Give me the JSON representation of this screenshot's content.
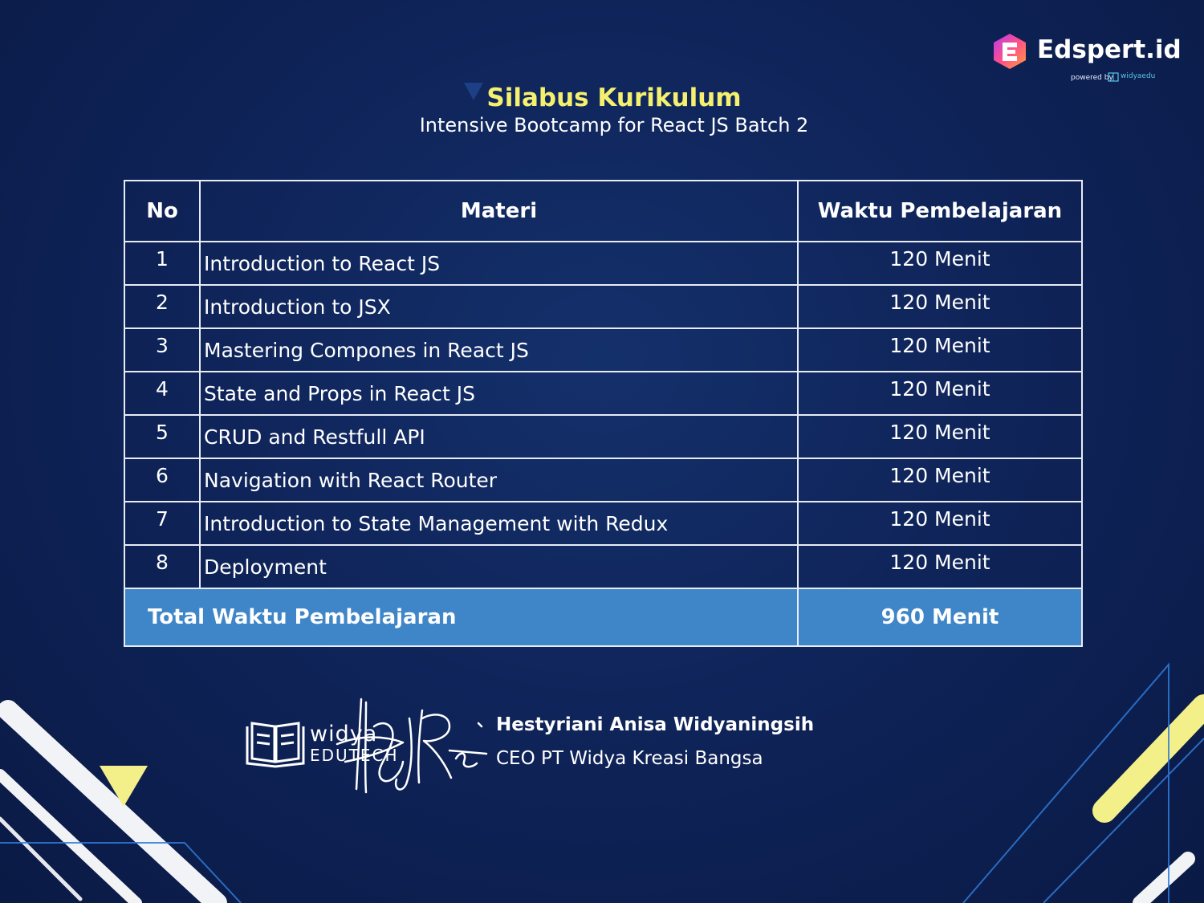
{
  "brand": {
    "name": "Edspert.id",
    "powered_by": "powered by",
    "partner": "widyaedu"
  },
  "header": {
    "title": "Silabus Kurikulum",
    "subtitle": "Intensive Bootcamp for React JS Batch 2"
  },
  "table": {
    "columns": [
      "No",
      "Materi",
      "Waktu Pembelajaran"
    ],
    "rows": [
      {
        "no": "1",
        "materi": "Introduction to React JS",
        "waktu": "120 Menit"
      },
      {
        "no": "2",
        "materi": "Introduction to JSX",
        "waktu": "120 Menit"
      },
      {
        "no": "3",
        "materi": "Mastering Compones in React JS",
        "waktu": "120 Menit"
      },
      {
        "no": "4",
        "materi": "State and Props in React JS",
        "waktu": "120 Menit"
      },
      {
        "no": "5",
        "materi": "CRUD and Restfull API",
        "waktu": "120 Menit"
      },
      {
        "no": "6",
        "materi": "Navigation with React Router",
        "waktu": "120 Menit"
      },
      {
        "no": "7",
        "materi": "Introduction to State Management with Redux",
        "waktu": "120 Menit"
      },
      {
        "no": "8",
        "materi": "Deployment",
        "waktu": "120 Menit"
      }
    ],
    "total": {
      "label": "Total Waktu Pembelajaran",
      "value": "960 Menit"
    }
  },
  "signature": {
    "logo_line1": "widya",
    "logo_line2": "EDUTECH",
    "name": "Hestyriani Anisa Widyaningsih",
    "role": "CEO PT Widya Kreasi Bangsa"
  },
  "colors": {
    "background": "#0e2256",
    "title": "#f5f06d",
    "total_row": "#3f86c8",
    "accent_yellow": "#f3f08a"
  }
}
